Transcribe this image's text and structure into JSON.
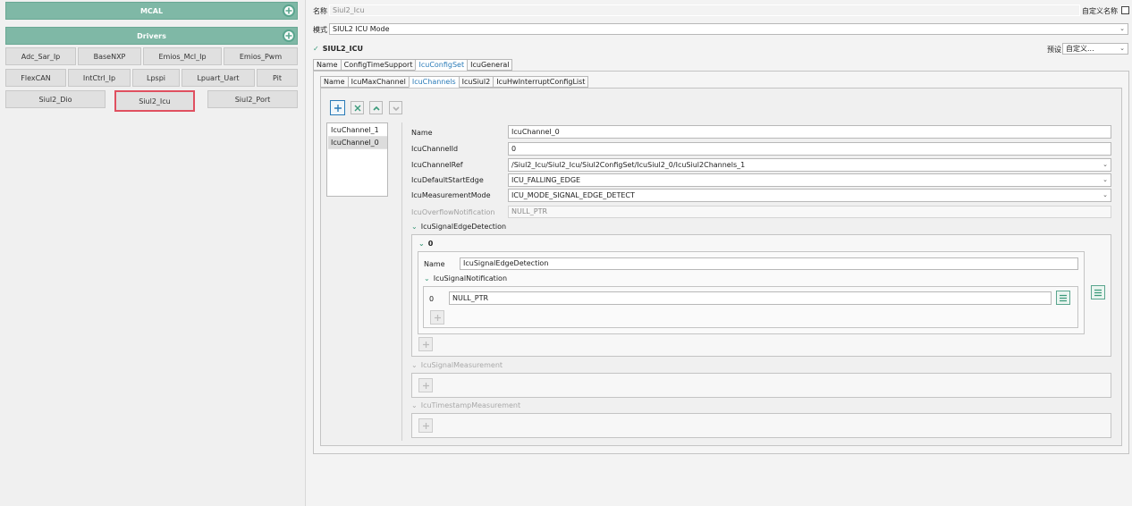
{
  "left": {
    "mcal_label": "MCAL",
    "drivers_label": "Drivers",
    "drivers": [
      [
        "Adc_Sar_Ip",
        "BaseNXP",
        "Emios_Mcl_Ip",
        "Emios_Pwm"
      ],
      [
        "FlexCAN",
        "IntCtrl_Ip",
        "Lpspi",
        "Lpuart_Uart",
        "Pit"
      ],
      [
        "Siul2_Dio",
        "Siul2_Icu",
        "Siul2_Port"
      ]
    ],
    "selected_driver": "Siul2_Icu"
  },
  "header": {
    "name_label": "名称",
    "name_value": "Siul2_Icu",
    "custom_name_label": "自定义名称",
    "mode_label": "模式",
    "mode_value": "SIUL2 ICU Mode",
    "section_title": "SIUL2_ICU",
    "preset_label": "预设",
    "preset_value": "自定义..."
  },
  "tabs_outer": [
    "Name",
    "ConfigTimeSupport",
    "IcuConfigSet",
    "IcuGeneral"
  ],
  "tabs_outer_active": 2,
  "tabs_inner": [
    "Name",
    "IcuMaxChannel",
    "IcuChannels",
    "IcuSiul2",
    "IcuHwInterruptConfigList"
  ],
  "tabs_inner_active": 2,
  "channel_list": [
    "IcuChannel_1",
    "IcuChannel_0"
  ],
  "selected_channel": 1,
  "form": {
    "name_label": "Name",
    "name_value": "IcuChannel_0",
    "id_label": "IcuChannelId",
    "id_value": "0",
    "ref_label": "IcuChannelRef",
    "ref_value": "/Siul2_Icu/Siul2_Icu/Siul2ConfigSet/IcuSiul2_0/IcuSiul2Channels_1",
    "edge_label": "IcuDefaultStartEdge",
    "edge_value": "ICU_FALLING_EDGE",
    "mode_label": "IcuMeasurementMode",
    "mode_value": "ICU_MODE_SIGNAL_EDGE_DETECT",
    "overflow_label": "IcuOverflowNotification",
    "overflow_value": "NULL_PTR"
  },
  "edge_detection": {
    "title": "IcuSignalEdgeDetection",
    "item_index": "0",
    "name_label": "Name",
    "name_value": "IcuSignalEdgeDetection",
    "notification_title": "IcuSignalNotification",
    "notification_index": "0",
    "notification_value": "NULL_PTR"
  },
  "signal_measurement_title": "IcuSignalMeasurement",
  "timestamp_measurement_title": "IcuTimestampMeasurement",
  "colors": {
    "accent": "#5aa58e",
    "header_bg": "#7fb8a6",
    "selection_border": "#e05060",
    "active_tab": "#2a7bb8"
  },
  "icons": [
    "plus-icon",
    "close-icon",
    "chevron-up-icon",
    "chevron-down-icon",
    "menu-icon"
  ]
}
